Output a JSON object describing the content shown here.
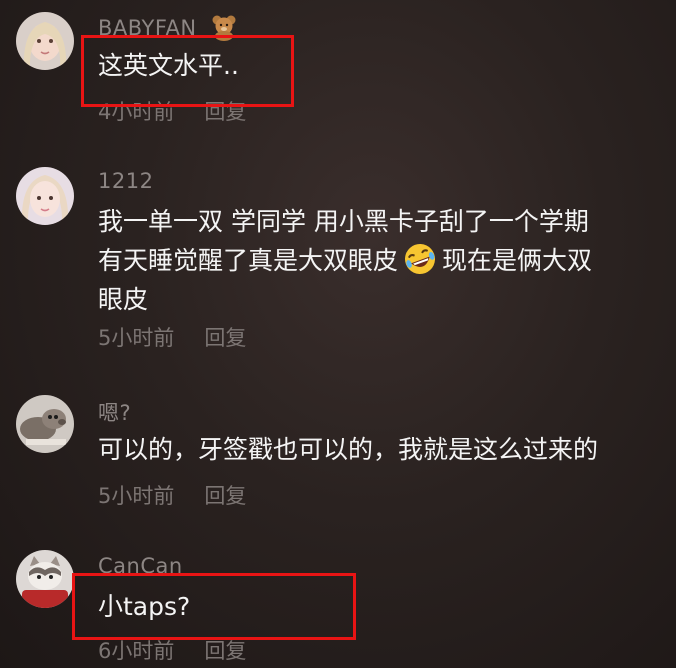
{
  "comments": [
    {
      "username": "BABYFAN",
      "badge_icon": "teddy-bear-icon",
      "text": "这英文水平..",
      "time": "4小时前",
      "reply": "回复",
      "highlighted": true
    },
    {
      "username": "1212",
      "text_lines": [
        "我一单一双 学同学 用小黑卡子刮了一个学期",
        "有天睡觉醒了真是大双眼皮",
        "现在是俩大双",
        "眼皮"
      ],
      "emoji": "rofl-emoji-icon",
      "time": "5小时前",
      "reply": "回复"
    },
    {
      "username": "嗯?",
      "text": "可以的，牙签戳也可以的，我就是这么过来的",
      "time": "5小时前",
      "reply": "回复"
    },
    {
      "username": "CanCan",
      "text": "小taps?",
      "time": "6小时前",
      "reply": "回复",
      "highlighted": true
    }
  ],
  "colors": {
    "highlight": "#e81414",
    "username": "#8d8684",
    "meta": "#7c7573",
    "text": "#f4f4f4"
  }
}
